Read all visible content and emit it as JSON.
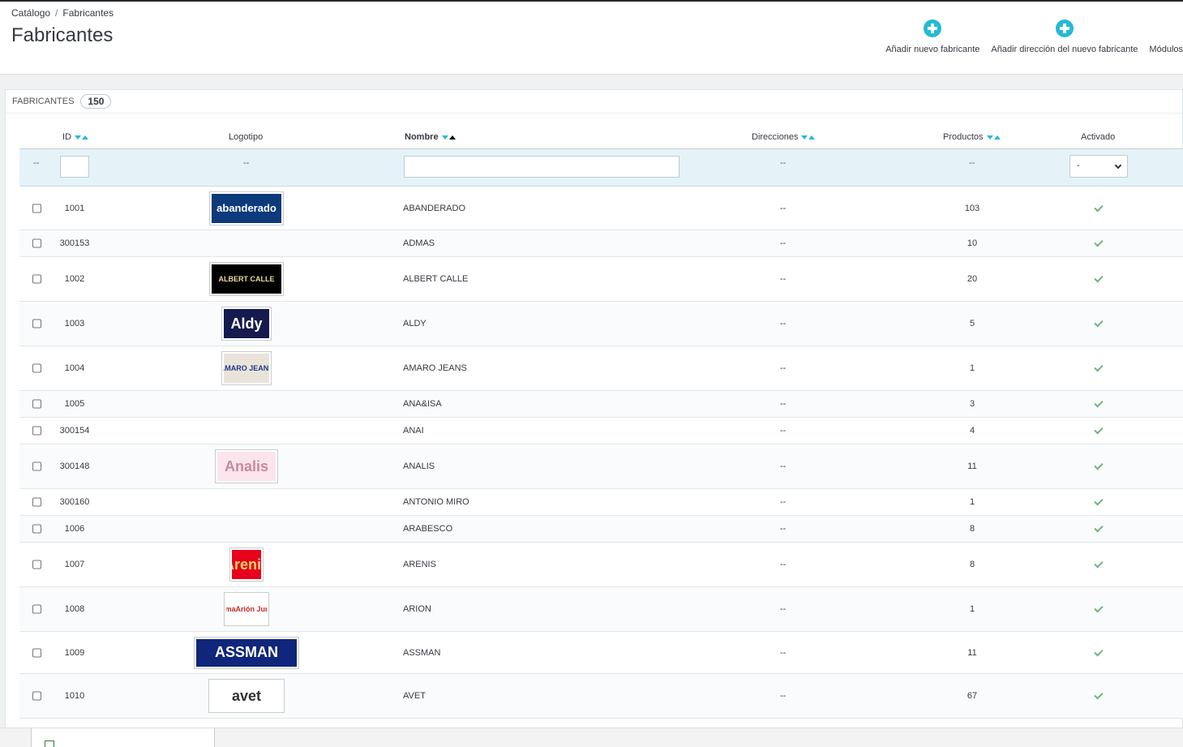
{
  "breadcrumb": {
    "parent": "Catálogo",
    "separator": "/",
    "current": "Fabricantes"
  },
  "page_title": "Fabricantes",
  "toolbar": {
    "add_manufacturer": "Añadir nuevo fabricante",
    "add_address": "Añadir dirección del nuevo fabricante",
    "modules": "Módulos"
  },
  "panel": {
    "title": "Fabricantes",
    "count": "150"
  },
  "columns": {
    "id": "ID",
    "logo": "Logotipo",
    "name": "Nombre",
    "addresses": "Direcciones",
    "products": "Productos",
    "active": "Activado"
  },
  "filters": {
    "placeholder_dash": "--",
    "active_selected": "-"
  },
  "rows": [
    {
      "id": "1001",
      "name": "ABANDERADO",
      "addresses": "--",
      "products": "103",
      "logo_text": "abanderado",
      "logo_bg": "#0d3a7a",
      "logo_fg": "#ffffff"
    },
    {
      "id": "300153",
      "name": "ADMAS",
      "addresses": "--",
      "products": "10",
      "logo_text": "",
      "logo_bg": "",
      "logo_fg": ""
    },
    {
      "id": "1002",
      "name": "ALBERT CALLE",
      "addresses": "--",
      "products": "20",
      "logo_text": "ALBERT CALLE",
      "logo_bg": "#000000",
      "logo_fg": "#e8d9a0"
    },
    {
      "id": "1003",
      "name": "ALDY",
      "addresses": "--",
      "products": "5",
      "logo_text": "Aldy",
      "logo_bg": "#151b4f",
      "logo_fg": "#ffffff"
    },
    {
      "id": "1004",
      "name": "AMARO JEANS",
      "addresses": "--",
      "products": "1",
      "logo_text": "AMARO JEANS",
      "logo_bg": "#e9e3da",
      "logo_fg": "#1b3a8a"
    },
    {
      "id": "1005",
      "name": "ANA&ISA",
      "addresses": "--",
      "products": "3",
      "logo_text": "",
      "logo_bg": "",
      "logo_fg": ""
    },
    {
      "id": "300154",
      "name": "ANAI",
      "addresses": "--",
      "products": "4",
      "logo_text": "",
      "logo_bg": "",
      "logo_fg": ""
    },
    {
      "id": "300148",
      "name": "ANALIS",
      "addresses": "--",
      "products": "11",
      "logo_text": "Analis",
      "logo_bg": "#fce4ec",
      "logo_fg": "#c48b9f"
    },
    {
      "id": "300160",
      "name": "ANTONIO MIRO",
      "addresses": "--",
      "products": "1",
      "logo_text": "",
      "logo_bg": "",
      "logo_fg": ""
    },
    {
      "id": "1006",
      "name": "ARABESCO",
      "addresses": "--",
      "products": "8",
      "logo_text": "",
      "logo_bg": "",
      "logo_fg": ""
    },
    {
      "id": "1007",
      "name": "ARENIS",
      "addresses": "--",
      "products": "8",
      "logo_text": "Arenis",
      "logo_bg": "#e8001d",
      "logo_fg": "#ffd56b"
    },
    {
      "id": "1008",
      "name": "ARION",
      "addresses": "--",
      "products": "1",
      "logo_text": "infimaArión Junior",
      "logo_bg": "#ffffff",
      "logo_fg": "#c62828"
    },
    {
      "id": "1009",
      "name": "ASSMAN",
      "addresses": "--",
      "products": "11",
      "logo_text": "ASSMAN",
      "logo_bg": "#10267a",
      "logo_fg": "#ffffff"
    },
    {
      "id": "1010",
      "name": "AVET",
      "addresses": "--",
      "products": "67",
      "logo_text": "avet",
      "logo_bg": "#ffffff",
      "logo_fg": "#333333"
    }
  ]
}
